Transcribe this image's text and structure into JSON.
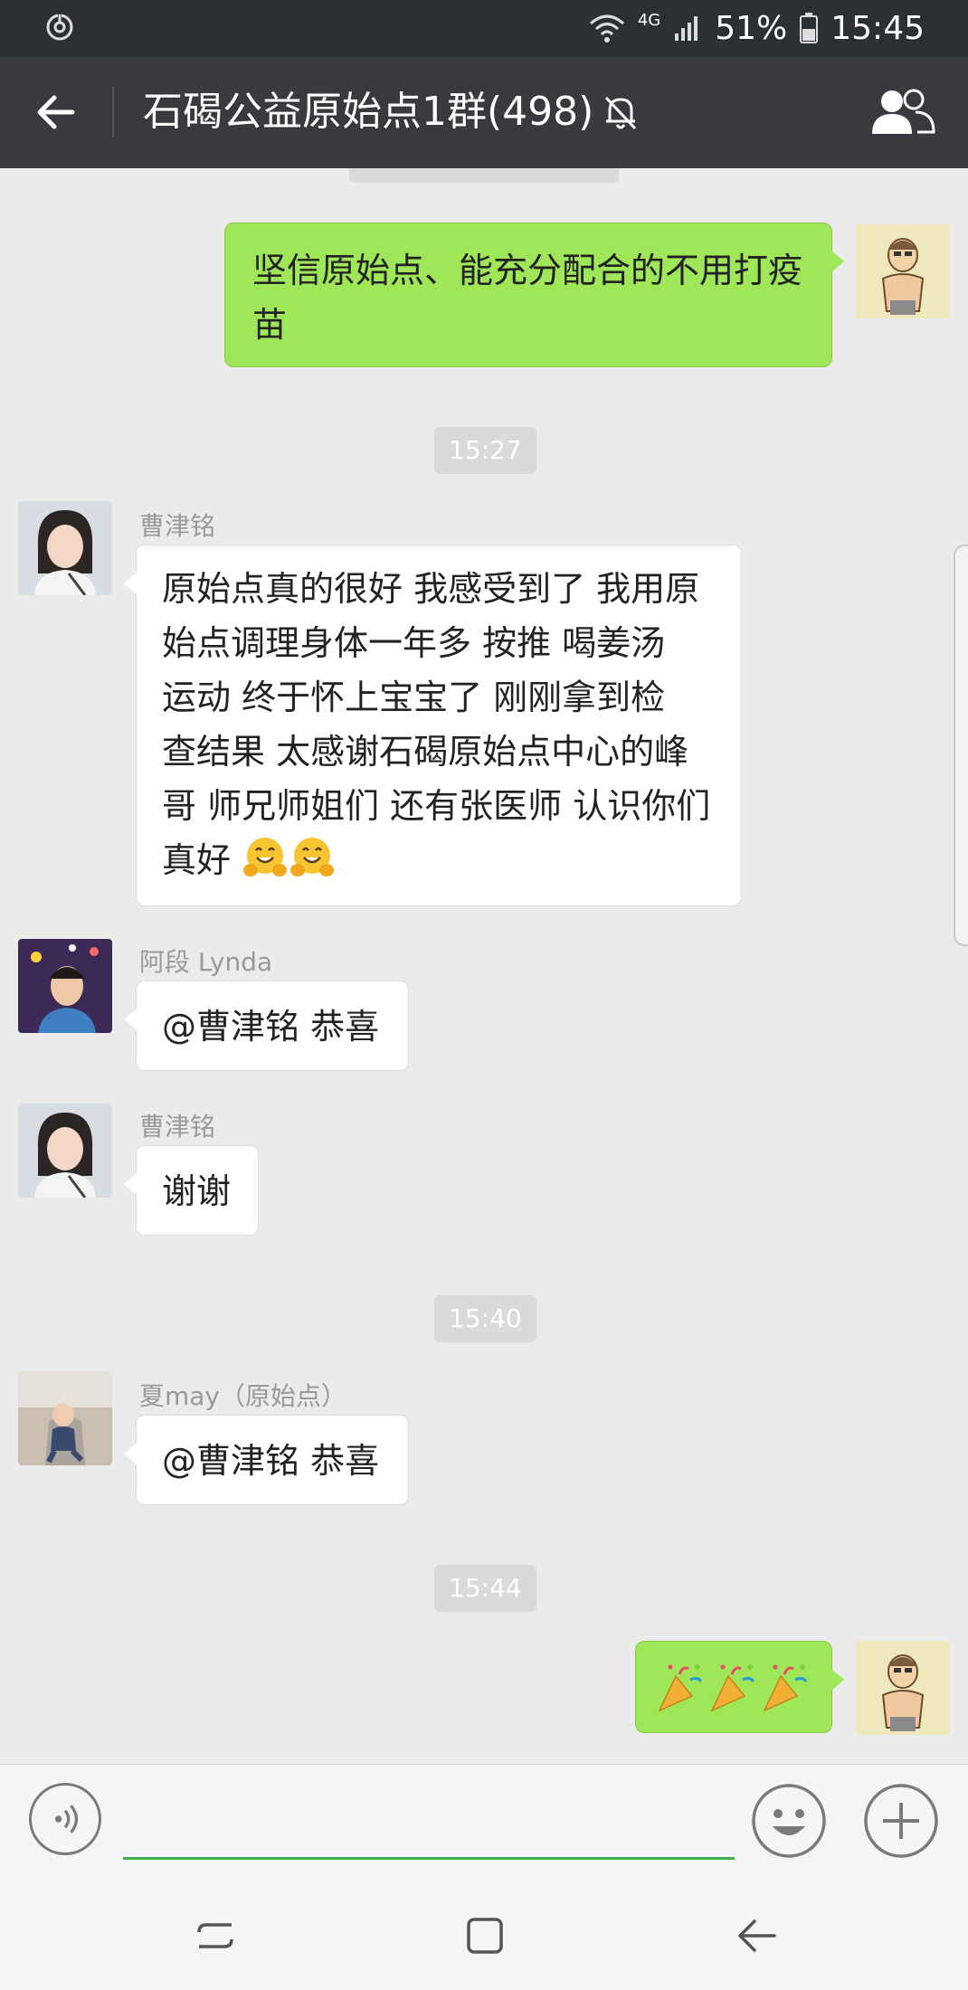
{
  "status_bar": {
    "network": "4G",
    "battery": "51%",
    "time": "15:45"
  },
  "header": {
    "title": "石碣公益原始点1群(498)"
  },
  "messages": {
    "m1": {
      "text": "坚信原始点、能充分配合的不用打疫苗"
    },
    "t1": "15:27",
    "m2": {
      "sender": "曹津铭",
      "lines": [
        "原始点真的很好 我感受到了 我用原",
        "始点调理身体一年多 按推 喝姜汤",
        "运动  终于怀上宝宝了 刚刚拿到检",
        "查结果 太感谢石碣原始点中心的峰",
        "哥 师兄师姐们 还有张医师 认识你们",
        "真好"
      ]
    },
    "m3": {
      "sender": "阿段 Lynda",
      "text": "@曹津铭 恭喜"
    },
    "m4": {
      "sender": "曹津铭",
      "text": "谢谢"
    },
    "t2": "15:40",
    "m5": {
      "sender": "夏may（原始点）",
      "text": "@曹津铭 恭喜"
    },
    "t3": "15:44"
  },
  "icons": {
    "party_emoji": "party-popper",
    "hug_emoji": "hugging-face"
  }
}
